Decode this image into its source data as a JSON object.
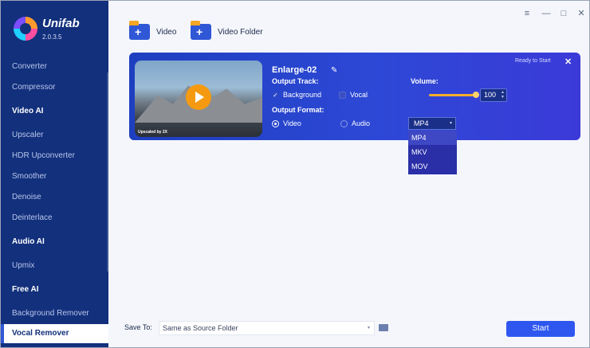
{
  "app": {
    "name": "Unifab",
    "version": "2.0.3.5"
  },
  "sidebar": {
    "items": [
      {
        "label": "Converter",
        "type": "item"
      },
      {
        "label": "Compressor",
        "type": "item"
      },
      {
        "label": "Video AI",
        "type": "heading"
      },
      {
        "label": "Upscaler",
        "type": "item"
      },
      {
        "label": "HDR Upconverter",
        "type": "item"
      },
      {
        "label": "Smoother",
        "type": "item"
      },
      {
        "label": "Denoise",
        "type": "item"
      },
      {
        "label": "Deinterlace",
        "type": "item"
      },
      {
        "label": "Audio AI",
        "type": "heading"
      },
      {
        "label": "Upmix",
        "type": "item"
      },
      {
        "label": "Free AI",
        "type": "heading"
      },
      {
        "label": "Background Remover",
        "type": "item"
      },
      {
        "label": "Vocal Remover",
        "type": "item",
        "active": true
      }
    ]
  },
  "toolbar": {
    "add_video": "Video",
    "add_folder": "Video Folder"
  },
  "window_controls": {
    "menu": "≡",
    "minimize": "—",
    "maximize": "□",
    "close": "✕"
  },
  "task": {
    "title": "Enlarge-02",
    "status": "Ready to Start",
    "thumbnail_caption": "Upscaled by 2X",
    "output_track_label": "Output Track:",
    "track_options": {
      "background": "Background",
      "vocal": "Vocal"
    },
    "track_checked": {
      "background": true,
      "vocal": false
    },
    "volume_label": "Volume:",
    "volume_value": "100",
    "output_format_label": "Output Format:",
    "format_options": {
      "video": "Video",
      "audio": "Audio"
    },
    "format_selected": "Video",
    "container_selected": "MP4",
    "container_options": [
      "MP4",
      "MKV",
      "MOV"
    ]
  },
  "footer": {
    "save_to_label": "Save To:",
    "save_to_value": "Same as Source Folder",
    "start_label": "Start"
  },
  "colors": {
    "sidebar": "#12307c",
    "accent": "#2f57f0",
    "card": "#2d48d6",
    "play": "#f59a10"
  }
}
